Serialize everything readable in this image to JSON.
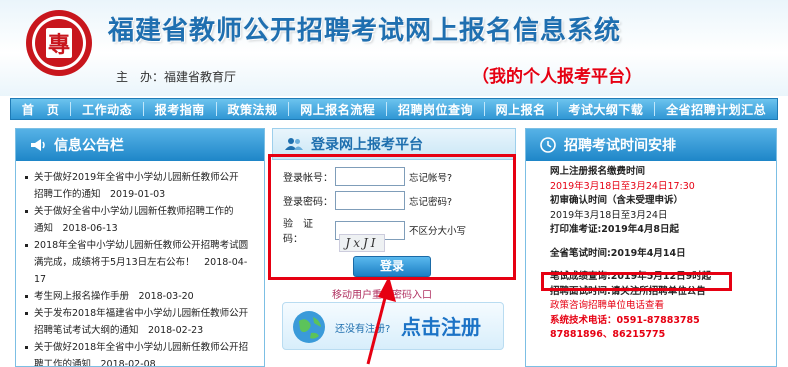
{
  "header": {
    "title": "福建省教师公开招聘考试网上报名信息系统",
    "sponsor": "主　办：福建省教育厅",
    "platform": "（我的个人报考平台）",
    "emblem_glyph": "專",
    "brand_red": "#c8161d",
    "title_blue": "#1f6fb0"
  },
  "nav": [
    "首　页",
    "工作动态",
    "报考指南",
    "政策法规",
    "网上报名流程",
    "招聘岗位查询",
    "网上报名",
    "考试大纲下载",
    "全省招聘计划汇总"
  ],
  "notices": {
    "title": "信息公告栏",
    "icon": "megaphone-icon",
    "items": [
      [
        "关于做好2019年全省中小学幼儿园新任教师公开",
        "招聘工作的通知　2019-01-03"
      ],
      [
        "关于做好全省中小学幼儿园新任教师招聘工作的",
        "通知　2018-06-13"
      ],
      [
        "2018年全省中小学幼儿园新任教师公开招聘考试圆",
        "满完成，成绩将于5月13日左右公布！　2018-04-17"
      ],
      [
        "考生网上报名操作手册　2018-03-20"
      ],
      [
        "关于发布2018年福建省中小学幼儿园新任教师公开",
        "招聘笔试考试大纲的通知　2018-02-23"
      ],
      [
        "关于做好2018年全省中小学幼儿园新任教师公开招",
        "聘工作的通知　2018-02-08"
      ]
    ]
  },
  "login": {
    "title": "登录网上报考平台",
    "icon": "users-icon",
    "account_label": "登录帐号：",
    "password_label": "登录密码：",
    "captcha_label": "验　证　码：",
    "account_value": "",
    "password_value": "",
    "captcha_value": "",
    "forgot_account": "忘记帐号?",
    "forgot_password": "忘记密码?",
    "captcha_hint": "不区分大小写",
    "captcha_text": "JxJI",
    "login_button": "登录",
    "reset_link": "移动用户重置密码入口",
    "register_ask": "还没有注册?",
    "register_button": "点击注册"
  },
  "schedule": {
    "title": "招聘考试时间安排",
    "icon": "clock-icon",
    "lines": [
      {
        "text": "网上注册报名缴费时间",
        "bold": true,
        "red": false
      },
      {
        "text": "2019年3月18日至3月24日17:30",
        "bold": false,
        "red": true
      },
      {
        "text": "初审确认时间（含未受理申诉）",
        "bold": true,
        "red": false
      },
      {
        "text": "2019年3月18日至3月24日",
        "bold": false,
        "red": false
      },
      {
        "text": "打印准考证:2019年4月8日起",
        "bold": true,
        "red": false
      },
      {
        "text": "",
        "bold": false,
        "red": false
      },
      {
        "text": "全省笔试时间:2019年4月14日",
        "bold": true,
        "red": false
      },
      {
        "text": "",
        "bold": false,
        "red": false
      },
      {
        "text": "笔试成绩查询:2019年5月12日9时起",
        "bold": true,
        "red": false
      },
      {
        "text": "招聘面试时间:请关注所招聘单位公告",
        "bold": true,
        "red": false
      },
      {
        "text": "政策咨询招聘单位电话查看",
        "bold": false,
        "red": true
      },
      {
        "text": "系统技术电话：0591-87883785",
        "bold": true,
        "red": true
      },
      {
        "text": "87881896、86215775",
        "bold": true,
        "red": true
      }
    ]
  },
  "colors": {
    "nav_blue": "#2f96d4",
    "highlight_red": "#e60012"
  }
}
